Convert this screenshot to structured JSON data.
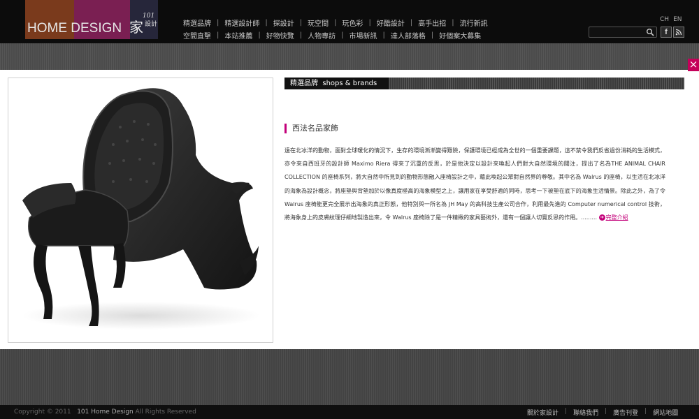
{
  "header": {
    "logo_text": "HOME DESIGN",
    "logo_number": "101",
    "logo_han": "家",
    "logo_han_small": "設計",
    "nav_row1": [
      "精選品牌",
      "精選設計師",
      "探設計",
      "玩空間",
      "玩色彩",
      "好酷設計",
      "高手出招",
      "流行新訊"
    ],
    "nav_row2": [
      "空間直擊",
      "本站推薦",
      "好物快覽",
      "人物專訪",
      "市場新訊",
      "達人部落格",
      "好個案大募集"
    ],
    "lang": [
      "CH",
      "EN"
    ],
    "search": {
      "value": "",
      "placeholder": ""
    },
    "social": [
      {
        "icon": "facebook-icon",
        "glyph": "f"
      },
      {
        "icon": "rss-icon",
        "glyph": ""
      }
    ]
  },
  "modal": {
    "close_glyph": "×",
    "section_label": "精選品牌",
    "section_label_en": "shops & brands",
    "heading": "西法名品家飾",
    "image_alt": "rhino chair",
    "body": "遠在北冰洋的動物，面對全球暖化的情況下，生存的環境漸漸變得艱險，保護環境已經成為全世的一個重要課題，這不禁令我們反省過份消耗的生活模式，亦令來自西班牙的設計師 Maximo Riera 得來了沉重的反思，於是他決定以設計來喚起人們對大自然環境的關注，提出了名為THE ANIMAL CHAIR COLLECTION 的座椅系列，將大自然中所見到的動物形態融入座椅設計之中，藉此喚起公眾對自然界的尊敬。其中名為 Walrus 的座椅，以生活在北冰洋的海象為設計概念，將座墊與背墊加於以像真度極高的海象模型之上，讓用家在享受舒適的同時，思考一下被墊在底下的海象生活情景。除此之外，為了令 Walrus 座椅能更完全展示出海象的真正形態，他特別與一所名為 JH May 的高科技生產公司合作，利用最先進的 Computer numerical control 技術，將海象身上的皮膚紋理仔細地製造出來，令 Walrus 座椅除了是一件精緻的家具藝術外，還有一個讓人切實反思的作用。.........",
    "more_label": "完整介紹",
    "more_icon": "arrow-circle-icon"
  },
  "footer": {
    "copyright": "Copyright © 2011",
    "brand": "101 Home Design",
    "rights": "All Rights Reserved",
    "links": [
      "關於家設計",
      "聯絡我們",
      "廣告刊登",
      "網站地圖"
    ]
  },
  "colors": {
    "accent": "#c3007a",
    "close": "#c5005a",
    "header_bg": "#0c0c0c",
    "page_bg": "#4e4e4e"
  }
}
